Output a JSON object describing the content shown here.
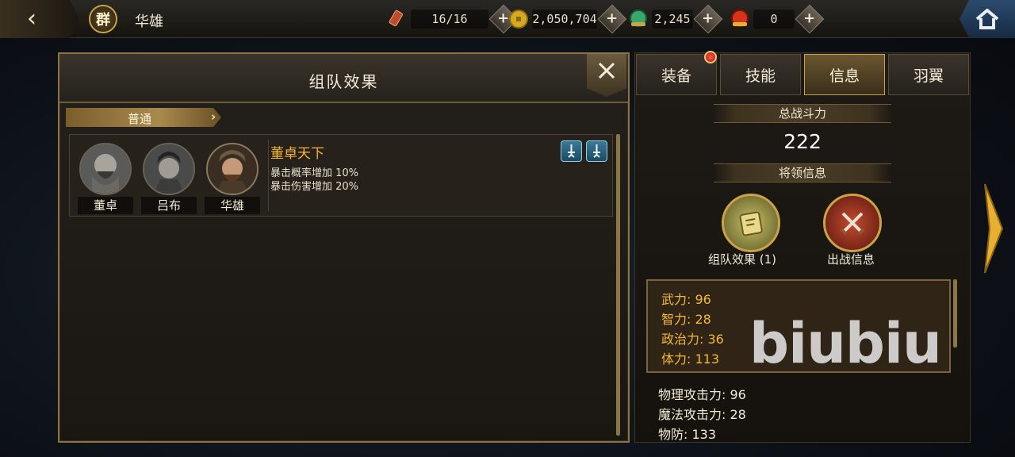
{
  "topbar": {
    "faction": "群",
    "hero_name": "华雄",
    "stamina": "16/16",
    "gold": "2,050,704",
    "jade": "2,245",
    "ruby": "0"
  },
  "dialog": {
    "title": "组队效果",
    "tab_label": "普通",
    "combo": {
      "title": "董卓天下",
      "effects": [
        "暴击概率增加  10%",
        "暴击伤害增加  20%"
      ],
      "members": [
        "董卓",
        "吕布",
        "华雄"
      ]
    }
  },
  "right": {
    "tabs": [
      "装备",
      "技能",
      "信息",
      "羽翼"
    ],
    "active_tab": "信息",
    "power_label": "总战斗力",
    "power_value": "222",
    "general_info_label": "将领信息",
    "team_effect_label": "组队效果 (1)",
    "battle_info_label": "出战信息",
    "attrs": [
      "武力: 96",
      "智力: 28",
      "政治力: 36",
      "体力: 113"
    ],
    "attrs2": [
      "物理攻击力: 96",
      "魔法攻击力: 28",
      "物防: 133"
    ],
    "watermark": "biubiu"
  },
  "colors": {
    "gold_accent": "#c9a24a",
    "title_gold": "#f3b932",
    "active_tab": "#6a5630"
  }
}
